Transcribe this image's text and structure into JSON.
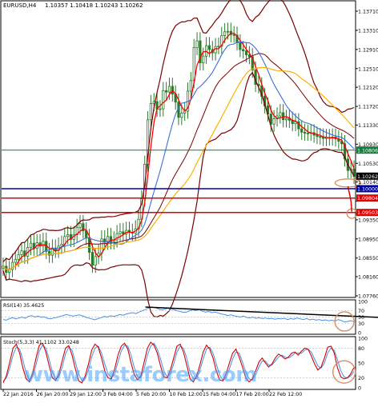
{
  "chart_title": "EURUSD,H4",
  "chart_values": "1.10357 1.10418 1.10243 1.10262",
  "rsi_label": "RSI(14) 35.4625",
  "stoch_label": "Stoch(5,3,3) 41.1102 33.0248",
  "watermark": "www.instaforex.com",
  "colors": {
    "candles": "#2b7a2b",
    "bollinger": "#7a0000",
    "ma_red": "#ff0000",
    "ma_blue": "#3a6fd8",
    "ma_orange": "#ffb000",
    "trend": "#000000",
    "rsi": "#4a90e2",
    "stoch_main": "#d40000",
    "stoch_signal": "#4a90e2",
    "level_green": "#0f7d3a",
    "level_blue": "#0000aa",
    "level_red": "#e00000",
    "circle": "#d98c5f"
  },
  "levels": {
    "price_green": "1.10806",
    "price_current": "1.10262",
    "price_blue": "1.10000",
    "price_red1": "1.09804",
    "price_red2": "1.09503"
  },
  "chart_data": [
    {
      "type": "line",
      "title": "EURUSD,H4 1.10357 1.10418 1.10243 1.10262",
      "ylim": [
        1.0776,
        1.1371
      ],
      "yticks": [
        1.1371,
        1.1331,
        1.1291,
        1.1251,
        1.1212,
        1.1172,
        1.1133,
        1.1093,
        1.1053,
        1.1014,
        1.0974,
        1.0935,
        1.0895,
        1.0855,
        1.0816,
        1.0776
      ],
      "ytick_labels": [
        "1.13710",
        "1.13310",
        "1.12910",
        "1.12510",
        "1.12120",
        "1.11720",
        "1.11330",
        "1.10930",
        "1.10530",
        "1.10140",
        "1.09740",
        "1.09350",
        "1.08950",
        "1.08550",
        "1.08160",
        "1.07760"
      ],
      "x_labels": [
        "22 Jan 2016",
        "26 Jan 20:00",
        "29 Jan 12:00",
        "3 Feb 04:00",
        "5 Feb 20:00",
        "10 Feb 12:00",
        "15 Feb 04:00",
        "17 Feb 20:00",
        "22 Feb 12:00"
      ],
      "close": [
        1.0838,
        1.0825,
        1.0831,
        1.0846,
        1.0852,
        1.0862,
        1.087,
        1.0859,
        1.0877,
        1.0886,
        1.0875,
        1.0887,
        1.088,
        1.089,
        1.0869,
        1.0861,
        1.0876,
        1.0871,
        1.088,
        1.0884,
        1.09,
        1.0904,
        1.0894,
        1.0904,
        1.0919,
        1.0927,
        1.0912,
        1.0898,
        1.0867,
        1.084,
        1.0858,
        1.0865,
        1.0895,
        1.0888,
        1.09,
        1.0889,
        1.0893,
        1.0906,
        1.091,
        1.0905,
        1.0913,
        1.0909,
        1.0907,
        1.0916,
        1.0936,
        1.0979,
        1.1051,
        1.1144,
        1.1178,
        1.1182,
        1.1166,
        1.1167,
        1.1205,
        1.1202,
        1.1214,
        1.1198,
        1.1181,
        1.1149,
        1.1158,
        1.1162,
        1.1204,
        1.1226,
        1.1295,
        1.1309,
        1.1263,
        1.1277,
        1.1299,
        1.1291,
        1.1284,
        1.1297,
        1.1298,
        1.132,
        1.1328,
        1.1329,
        1.1322,
        1.1321,
        1.1305,
        1.1291,
        1.1288,
        1.128,
        1.1276,
        1.1248,
        1.1218,
        1.1215,
        1.1193,
        1.1173,
        1.1156,
        1.1135,
        1.1146,
        1.1152,
        1.1159,
        1.1144,
        1.1147,
        1.1143,
        1.1136,
        1.114,
        1.1125,
        1.1118,
        1.1116,
        1.1116,
        1.1117,
        1.1112,
        1.1109,
        1.1108,
        1.1105,
        1.1107,
        1.1106,
        1.1108,
        1.1104,
        1.1099,
        1.1094,
        1.1062,
        1.1038,
        1.1041,
        1.1026
      ],
      "levels": [
        1.10806,
        1.1,
        1.09804,
        1.09503
      ],
      "current": 1.10262
    },
    {
      "type": "line",
      "title": "RSI(14) 35.4625",
      "ylim": [
        0,
        100
      ],
      "yticks": [
        100,
        70,
        50,
        30,
        0
      ],
      "values": [
        42,
        40,
        45,
        48,
        44,
        47,
        50,
        46,
        52,
        55,
        50,
        53,
        49,
        51,
        46,
        44,
        47,
        49,
        52,
        55,
        58,
        56,
        53,
        55,
        57,
        54,
        50,
        47,
        44,
        41,
        45,
        48,
        52,
        50,
        54,
        52,
        55,
        58,
        56,
        60,
        62,
        64,
        61,
        66,
        70,
        74,
        79,
        82,
        80,
        77,
        73,
        75,
        78,
        76,
        74,
        70,
        68,
        65,
        66,
        70,
        73,
        71,
        74,
        69,
        66,
        68,
        64,
        66,
        63,
        60,
        58,
        55,
        57,
        54,
        52,
        50,
        53,
        49,
        47,
        50,
        46,
        48,
        45,
        47,
        44,
        46,
        43,
        45,
        44,
        46,
        42,
        45,
        43,
        47,
        44,
        42,
        45,
        41,
        43,
        40,
        42,
        39,
        41,
        38,
        40,
        37,
        42,
        39,
        34,
        36,
        38,
        35.5
      ],
      "trendline": [
        [
          45,
          82
        ],
        [
          125,
          46
        ]
      ]
    },
    {
      "type": "line",
      "title": "Stoch(5,3,3) 41.1102 33.0248",
      "ylim": [
        0,
        100
      ],
      "yticks": [
        100,
        80,
        50,
        20,
        0
      ],
      "main": [
        10,
        25,
        52,
        80,
        88,
        70,
        40,
        18,
        12,
        30,
        60,
        86,
        90,
        72,
        45,
        20,
        15,
        28,
        55,
        80,
        85,
        66,
        38,
        14,
        10,
        24,
        48,
        76,
        88,
        82,
        60,
        34,
        20,
        18,
        38,
        66,
        84,
        90,
        78,
        50,
        26,
        16,
        24,
        52,
        80,
        92,
        86,
        70,
        44,
        22,
        20,
        36,
        60,
        84,
        88,
        72,
        46,
        18,
        12,
        24,
        46,
        72,
        86,
        78,
        60,
        34,
        16,
        14,
        28,
        50,
        70,
        78,
        62,
        42,
        20,
        12,
        18,
        34,
        52,
        60,
        50,
        42,
        48,
        60,
        68,
        64,
        58,
        62,
        70,
        72,
        66,
        74,
        80,
        78,
        64,
        48,
        36,
        42,
        60,
        82,
        84,
        70,
        40,
        22,
        18,
        20,
        28,
        41
      ],
      "signal": [
        14,
        20,
        40,
        66,
        82,
        78,
        56,
        30,
        16,
        22,
        46,
        74,
        86,
        80,
        58,
        32,
        18,
        22,
        42,
        68,
        82,
        76,
        52,
        28,
        14,
        18,
        36,
        62,
        80,
        84,
        70,
        48,
        28,
        20,
        28,
        52,
        74,
        86,
        84,
        66,
        40,
        22,
        20,
        38,
        66,
        84,
        90,
        78,
        58,
        34,
        22,
        28,
        48,
        72,
        84,
        80,
        60,
        32,
        18,
        18,
        36,
        58,
        78,
        82,
        70,
        48,
        26,
        16,
        20,
        38,
        58,
        72,
        70,
        52,
        32,
        18,
        16,
        26,
        42,
        54,
        54,
        46,
        46,
        54,
        62,
        66,
        62,
        60,
        64,
        70,
        70,
        70,
        76,
        78,
        72,
        58,
        44,
        40,
        50,
        70,
        80,
        76,
        56,
        34,
        22,
        20,
        24,
        33
      ]
    }
  ]
}
